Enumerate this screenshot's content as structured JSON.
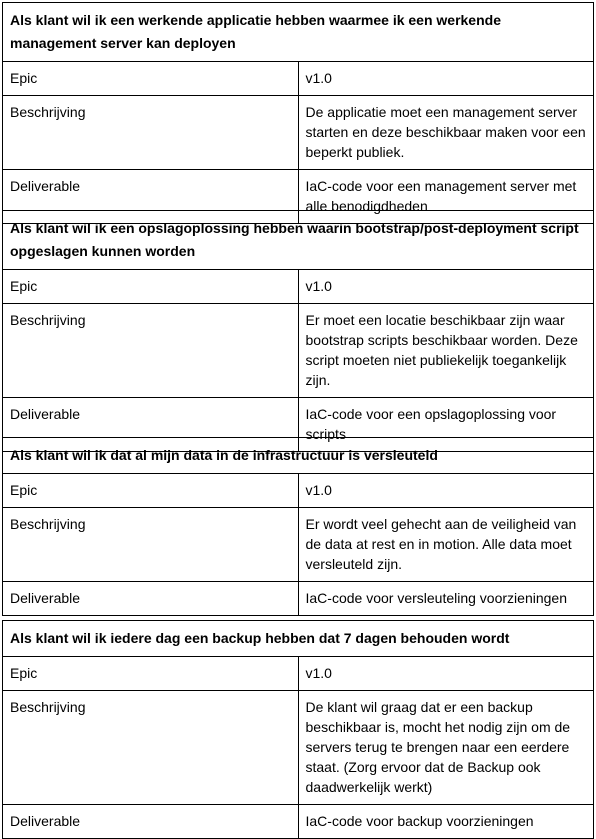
{
  "labels": {
    "epic": "Epic",
    "description": "Beschrijving",
    "deliverable": "Deliverable"
  },
  "stories": [
    {
      "title": "Als klant wil ik een werkende applicatie hebben waarmee ik een werkende management server kan deployen",
      "epic": "v1.0",
      "description": "De applicatie moet een management server starten en deze beschikbaar maken voor een beperkt publiek.",
      "deliverable": "IaC-code voor een management server met alle benodigdheden"
    },
    {
      "title": "Als klant wil ik een opslagoplossing hebben waarin bootstrap/post-deployment script opgeslagen kunnen worden",
      "epic": "v1.0",
      "description": "Er moet een locatie beschikbaar zijn waar bootstrap scripts beschikbaar worden. Deze script moeten niet publiekelijk toegankelijk zijn.",
      "deliverable": "IaC-code voor een opslagoplossing voor scripts"
    },
    {
      "title": "Als klant wil ik dat al mijn data in de infrastructuur is versleuteld",
      "epic": "v1.0",
      "description": "Er wordt veel gehecht aan de veiligheid van de data at rest en in motion. Alle data moet versleuteld zijn.",
      "deliverable": "IaC-code voor versleuteling voorzieningen"
    },
    {
      "title": "Als klant wil ik iedere dag een backup hebben dat 7 dagen behouden wordt",
      "epic": "v1.0",
      "description": "De klant wil graag dat er een backup beschikbaar is, mocht het nodig zijn om de servers terug te brengen naar een eerdere staat. (Zorg ervoor dat de Backup ook daadwerkelijk werkt)",
      "deliverable": "IaC-code voor backup voorzieningen"
    }
  ]
}
